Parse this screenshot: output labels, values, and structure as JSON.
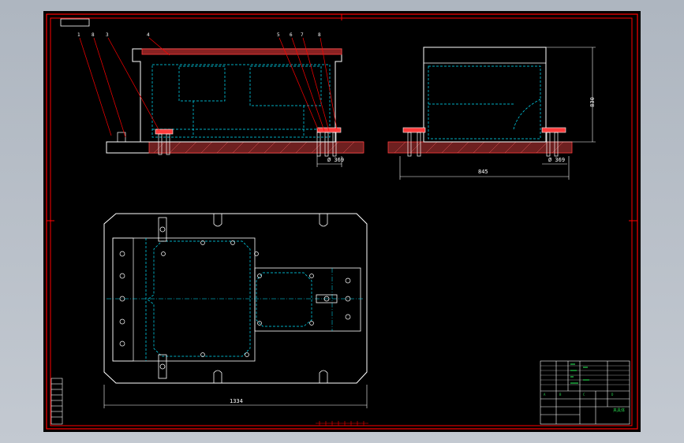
{
  "sheet": {
    "background": "#000000",
    "frame_color": "#ff0000",
    "outline_color": "#ffffff",
    "hidden_line_color": "#00e5ff",
    "leader_color": "#ff0000",
    "dimension_color": "#ffffff"
  },
  "front_view": {
    "part_labels": [
      "1",
      "8",
      "3",
      "4",
      "5",
      "6",
      "7",
      "8"
    ],
    "dimension_label": "Ø 369"
  },
  "side_view": {
    "dimension_width": "845",
    "dimension_height": "830",
    "dimension_label": "Ø 369"
  },
  "top_view": {
    "dimension_width": "1334"
  },
  "title_block": {
    "tag_1": "A",
    "tag_2": "B",
    "tag_3": "C",
    "tag_4": "D",
    "stamp": "夹具体"
  }
}
